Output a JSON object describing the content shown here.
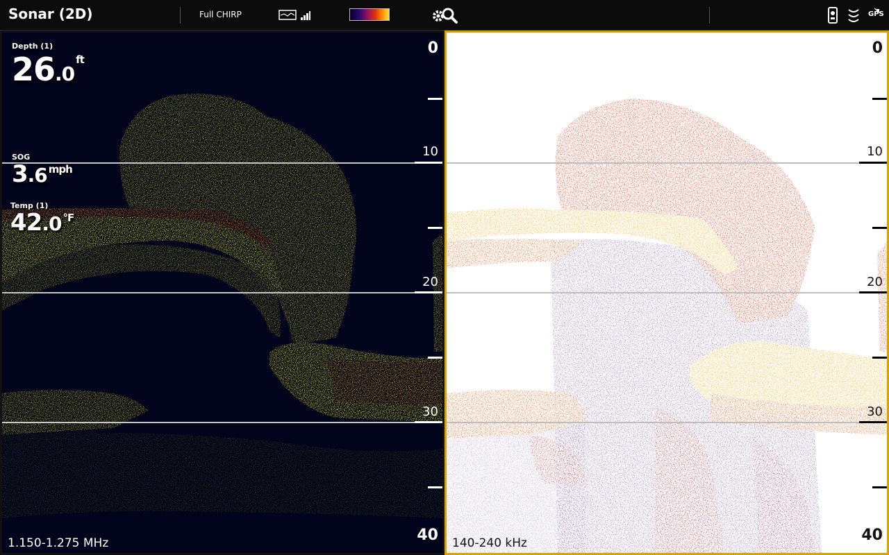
{
  "topbar": {
    "title": "Sonar (2D)",
    "mode": "Full CHIRP",
    "icons": [
      "sonar-view-icon",
      "signal-strength-icon",
      "color-palette",
      "settings-search-icon",
      "network-icon",
      "sonar-status-icon",
      "gps-status-icon"
    ],
    "gps_label": "GPS"
  },
  "left_pane": {
    "frequency": "1.150-1.275 MHz",
    "scale": {
      "top": "0",
      "mark10": "10",
      "mark20": "20",
      "mark30": "30",
      "bottom": "40"
    },
    "depth": {
      "label": "Depth (1)",
      "int": "26",
      "dec": ".0",
      "unit": "ft"
    },
    "sog": {
      "label": "SOG",
      "int": "3",
      "dec": ".6",
      "unit": "mph"
    },
    "temp": {
      "label": "Temp (1)",
      "int": "42",
      "dec": ".0",
      "unit": "°F"
    }
  },
  "right_pane": {
    "frequency": "140-240 kHz",
    "scale": {
      "top": "0",
      "mark10": "10",
      "mark20": "20",
      "mark30": "30",
      "bottom": "40"
    }
  },
  "colors": {
    "left_background": "#02041c",
    "left_signal": "#e8e820",
    "right_background": "#ffffff",
    "right_signal_strong": "#ff9a10",
    "right_signal_mid": "#e03010",
    "right_signal_weak": "#4a1a7a",
    "active_pane_border": "#d8a300"
  }
}
